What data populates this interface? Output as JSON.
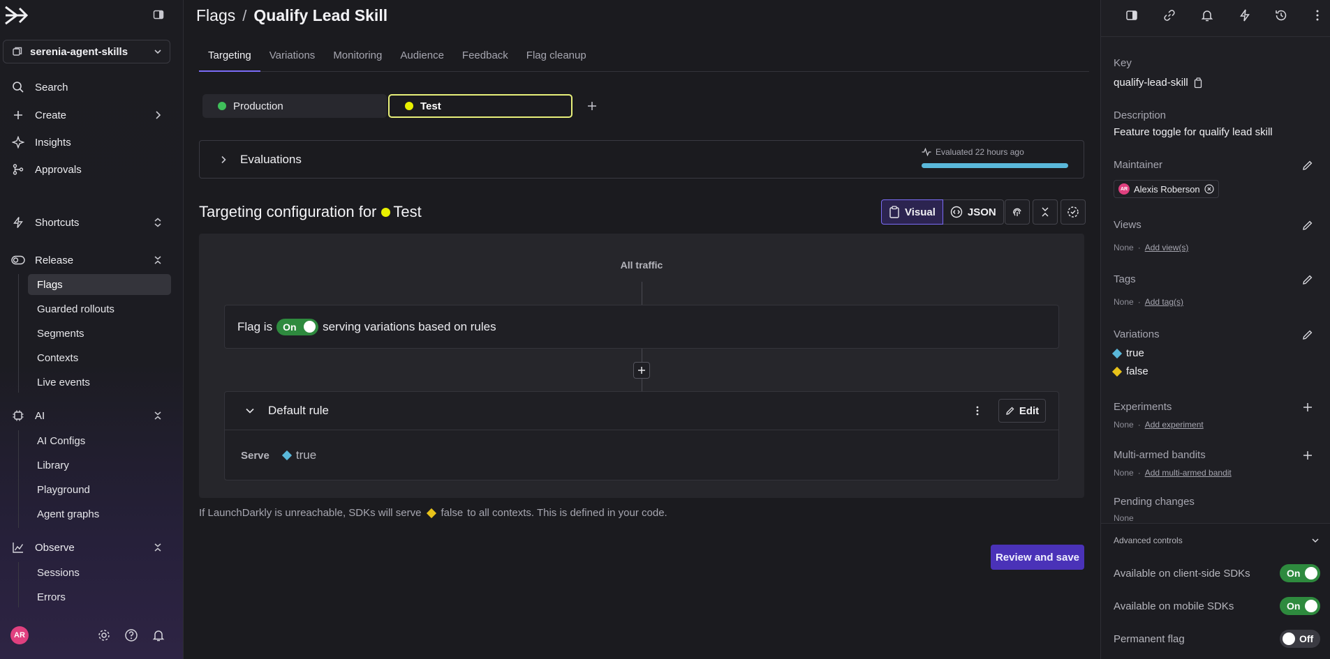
{
  "sidebar": {
    "project": "serenia-agent-skills",
    "nav": {
      "search": "Search",
      "create": "Create",
      "insights": "Insights",
      "approvals": "Approvals",
      "shortcuts": "Shortcuts",
      "release": "Release",
      "ai": "AI",
      "observe": "Observe"
    },
    "release_items": [
      "Flags",
      "Guarded rollouts",
      "Segments",
      "Contexts",
      "Live events"
    ],
    "ai_items": [
      "AI Configs",
      "Library",
      "Playground",
      "Agent graphs"
    ],
    "observe_items": [
      "Sessions",
      "Errors"
    ],
    "avatar": "AR"
  },
  "header": {
    "breadcrumb_root": "Flags",
    "separator": "/",
    "flag_name": "Qualify Lead Skill"
  },
  "tabs": [
    "Targeting",
    "Variations",
    "Monitoring",
    "Audience",
    "Feedback",
    "Flag cleanup"
  ],
  "environments": [
    {
      "name": "Production",
      "color": "#3fbf5a"
    },
    {
      "name": "Test",
      "color": "#e8f000"
    }
  ],
  "evaluations": {
    "label": "Evaluations",
    "meta": "Evaluated 22 hours ago",
    "accent": "#5ab8da"
  },
  "targeting": {
    "title_prefix": "Targeting configuration for",
    "env_name": "Test",
    "env_color": "#e8f000",
    "view_visual": "Visual",
    "view_json": "JSON",
    "all_traffic": "All traffic",
    "flag_is": "Flag is",
    "toggle": "On",
    "serving": "serving variations based on rules",
    "default_rule": "Default rule",
    "edit": "Edit",
    "serve_label": "Serve",
    "serve_value": "true",
    "footnote_prefix": "If LaunchDarkly is unreachable, SDKs will serve",
    "footnote_value": "false",
    "footnote_suffix": "to all contexts. This is defined in your code.",
    "review_button": "Review and save"
  },
  "details": {
    "key_label": "Key",
    "key_value": "qualify-lead-skill",
    "description_label": "Description",
    "description_value": "Feature toggle for qualify lead skill",
    "maintainer_label": "Maintainer",
    "maintainer_initials": "AR",
    "maintainer_name": "Alexis Roberson",
    "views_label": "Views",
    "views_none": "None",
    "views_link": "Add view(s)",
    "tags_label": "Tags",
    "tags_none": "None",
    "tags_link": "Add tag(s)",
    "variations_label": "Variations",
    "variations": [
      {
        "name": "true",
        "color": "#5ab8da"
      },
      {
        "name": "false",
        "color": "#e8c21a"
      }
    ],
    "experiments_label": "Experiments",
    "experiments_none": "None",
    "experiments_link": "Add experiment",
    "bandits_label": "Multi-armed bandits",
    "bandits_none": "None",
    "bandits_link": "Add multi-armed bandit",
    "pending_label": "Pending changes",
    "pending_none": "None",
    "advanced_label": "Advanced controls",
    "client_sdk_label": "Available on client-side SDKs",
    "client_sdk_value": "On",
    "mobile_sdk_label": "Available on mobile SDKs",
    "mobile_sdk_value": "On",
    "permanent_label": "Permanent flag",
    "permanent_value": "Off"
  },
  "colors": {
    "accent": "#7b6cf6",
    "primary_button": "#4a32b8",
    "toggle_on": "#2e8a3e"
  }
}
